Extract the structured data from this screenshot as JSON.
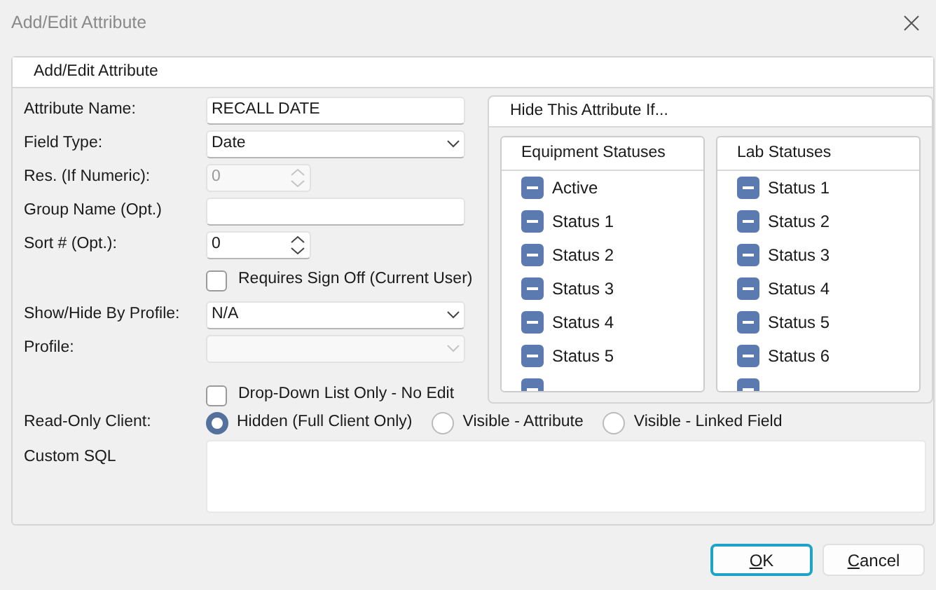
{
  "window": {
    "title": "Add/Edit Attribute"
  },
  "group_title": "Add/Edit Attribute",
  "fields": [
    {
      "kind": "text",
      "label": "Attribute Name:",
      "value": "RECALL DATE",
      "disabled": false
    },
    {
      "kind": "select",
      "label": "Field Type:",
      "value": "Date",
      "disabled": false
    },
    {
      "kind": "spin",
      "label": "Res. (If Numeric):",
      "value": "0",
      "disabled": true
    },
    {
      "kind": "text",
      "label": "Group Name (Opt.)",
      "disabled": false
    },
    {
      "kind": "spin",
      "label": "Sort # (Opt.):",
      "value": "0",
      "disabled": false
    },
    {
      "kind": "check",
      "text": "Requires Sign Off (Current User)",
      "checked": false
    },
    {
      "kind": "select",
      "label": "Show/Hide By Profile:",
      "value": "N/A",
      "disabled": false
    },
    {
      "kind": "select",
      "label": "Profile:",
      "disabled": true
    },
    {
      "kind": "check",
      "text": "Drop-Down List Only - No Edit",
      "checked": false
    }
  ],
  "read_only_client": {
    "label": "Read-Only Client:",
    "options": [
      {
        "text": "Hidden (Full Client Only)",
        "selected": true
      },
      {
        "text": "Visible - Attribute",
        "selected": false
      },
      {
        "text": "Visible - Linked Field",
        "selected": false
      }
    ]
  },
  "custom_sql": {
    "label": "Custom SQL"
  },
  "hide_panel": {
    "title": "Hide This Attribute If...",
    "lists": [
      {
        "title": "Equipment Statuses",
        "items": [
          {
            "text": "Active",
            "indeterminate": true
          },
          {
            "text": "Status 1",
            "indeterminate": true
          },
          {
            "text": "Status 2",
            "indeterminate": true
          },
          {
            "text": "Status 3",
            "indeterminate": true
          },
          {
            "text": "Status 4",
            "indeterminate": true
          },
          {
            "text": "Status 5",
            "indeterminate": true
          },
          {
            "indeterminate": true
          }
        ]
      },
      {
        "title": "Lab Statuses",
        "items": [
          {
            "text": "Status 1",
            "indeterminate": true
          },
          {
            "text": "Status 2",
            "indeterminate": true
          },
          {
            "text": "Status 3",
            "indeterminate": true
          },
          {
            "text": "Status 4",
            "indeterminate": true
          },
          {
            "text": "Status 5",
            "indeterminate": true
          },
          {
            "text": "Status 6",
            "indeterminate": true
          },
          {
            "indeterminate": true
          }
        ]
      }
    ]
  },
  "buttons": [
    {
      "text": "OK",
      "underline_first": true,
      "default": true
    },
    {
      "text": "Cancel",
      "underline_first": true,
      "default": false
    }
  ]
}
